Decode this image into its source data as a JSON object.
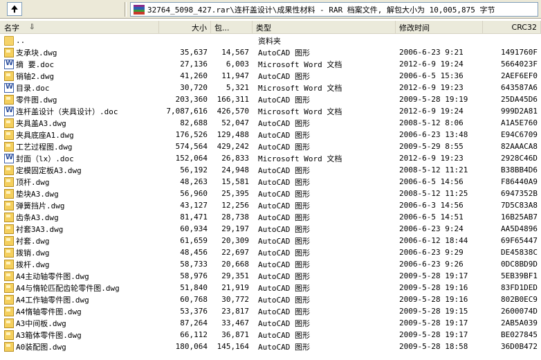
{
  "address_bar": {
    "path": "32764_5098_427.rar\\连杆盖设计\\成果性材料 - RAR 档案文件, 解包大小为 10,005,875 字节"
  },
  "columns": {
    "name": "名字",
    "size": "大小",
    "packed": "包...",
    "type": "类型",
    "modified": "修改时间",
    "crc": "CRC32"
  },
  "colors": {
    "header_bg": "#ebeadb",
    "toolbar_bg": "#ece9d8"
  },
  "rows": [
    {
      "icon": "folder-icon",
      "name": "..",
      "size": "",
      "packed": "",
      "type": "资料夹",
      "modified": "",
      "crc": ""
    },
    {
      "icon": "dwg-icon",
      "name": "支承块.dwg",
      "size": "35,637",
      "packed": "14,567",
      "type": "AutoCAD 图形",
      "modified": "2006-6-23 9:21",
      "crc": "1491760F"
    },
    {
      "icon": "doc-icon",
      "name": "摘   要.doc",
      "size": "27,136",
      "packed": "6,003",
      "type": "Microsoft Word 文档",
      "modified": "2012-6-9 19:24",
      "crc": "5664023F"
    },
    {
      "icon": "dwg-icon",
      "name": "销轴2.dwg",
      "size": "41,260",
      "packed": "11,947",
      "type": "AutoCAD 图形",
      "modified": "2006-6-5 15:36",
      "crc": "2AEF6EF0"
    },
    {
      "icon": "doc-icon",
      "name": "目录.doc",
      "size": "30,720",
      "packed": "5,321",
      "type": "Microsoft Word 文档",
      "modified": "2012-6-9 19:23",
      "crc": "643587A6"
    },
    {
      "icon": "dwg-icon",
      "name": "零件图.dwg",
      "size": "203,360",
      "packed": "166,311",
      "type": "AutoCAD 图形",
      "modified": "2009-5-28 19:19",
      "crc": "25DA45D6"
    },
    {
      "icon": "doc-icon",
      "name": "连杆盖设计（夹具设计）.doc",
      "size": "7,087,616",
      "packed": "426,570",
      "type": "Microsoft Word 文档",
      "modified": "2012-6-9 19:24",
      "crc": "999D2A81"
    },
    {
      "icon": "dwg-icon",
      "name": "夹具盖A3.dwg",
      "size": "82,688",
      "packed": "52,047",
      "type": "AutoCAD 图形",
      "modified": "2008-5-12 8:06",
      "crc": "A1A5E760"
    },
    {
      "icon": "dwg-icon",
      "name": "夹具底座A1.dwg",
      "size": "176,526",
      "packed": "129,488",
      "type": "AutoCAD 图形",
      "modified": "2006-6-23 13:48",
      "crc": "E94C6709"
    },
    {
      "icon": "dwg-icon",
      "name": "工艺过程图.dwg",
      "size": "574,564",
      "packed": "429,242",
      "type": "AutoCAD 图形",
      "modified": "2009-5-29 8:55",
      "crc": "82AAACA8"
    },
    {
      "icon": "doc-icon",
      "name": "封面（lx）.doc",
      "size": "152,064",
      "packed": "26,833",
      "type": "Microsoft Word 文档",
      "modified": "2012-6-9 19:23",
      "crc": "2928C46D"
    },
    {
      "icon": "dwg-icon",
      "name": "定模固定板A3.dwg",
      "size": "56,192",
      "packed": "24,948",
      "type": "AutoCAD 图形",
      "modified": "2008-5-12 11:21",
      "crc": "B38BB4D6"
    },
    {
      "icon": "dwg-icon",
      "name": "顶杆.dwg",
      "size": "48,263",
      "packed": "15,581",
      "type": "AutoCAD 图形",
      "modified": "2006-6-5 14:56",
      "crc": "F86440A9"
    },
    {
      "icon": "dwg-icon",
      "name": "垫块A3.dwg",
      "size": "56,960",
      "packed": "25,395",
      "type": "AutoCAD 图形",
      "modified": "2008-5-12 11:25",
      "crc": "6947352B"
    },
    {
      "icon": "dwg-icon",
      "name": "弹簧挡片.dwg",
      "size": "43,127",
      "packed": "12,256",
      "type": "AutoCAD 图形",
      "modified": "2006-6-3 14:56",
      "crc": "7D5C83A8"
    },
    {
      "icon": "dwg-icon",
      "name": "齿条A3.dwg",
      "size": "81,471",
      "packed": "28,738",
      "type": "AutoCAD 图形",
      "modified": "2006-6-5 14:51",
      "crc": "16B25AB7"
    },
    {
      "icon": "dwg-icon",
      "name": "衬套3A3.dwg",
      "size": "60,934",
      "packed": "29,197",
      "type": "AutoCAD 图形",
      "modified": "2006-6-23 9:24",
      "crc": "AA5D4896"
    },
    {
      "icon": "dwg-icon",
      "name": "衬套.dwg",
      "size": "61,659",
      "packed": "20,309",
      "type": "AutoCAD 图形",
      "modified": "2006-6-12 18:44",
      "crc": "69F65447"
    },
    {
      "icon": "dwg-icon",
      "name": "拨销.dwg",
      "size": "48,456",
      "packed": "22,697",
      "type": "AutoCAD 图形",
      "modified": "2006-6-23 9:29",
      "crc": "DE45838C"
    },
    {
      "icon": "dwg-icon",
      "name": "拨杆.dwg",
      "size": "58,733",
      "packed": "20,668",
      "type": "AutoCAD 图形",
      "modified": "2006-6-23 9:26",
      "crc": "0DC8BD9D"
    },
    {
      "icon": "dwg-icon",
      "name": "A4主动轴零件图.dwg",
      "size": "58,976",
      "packed": "29,351",
      "type": "AutoCAD 图形",
      "modified": "2009-5-28 19:17",
      "crc": "5EB39BF1"
    },
    {
      "icon": "dwg-icon",
      "name": "A4与惰轮匹配齿轮零件图.dwg",
      "size": "51,840",
      "packed": "21,919",
      "type": "AutoCAD 图形",
      "modified": "2009-5-28 19:16",
      "crc": "83FD1DED"
    },
    {
      "icon": "dwg-icon",
      "name": "A4工作轴零件图.dwg",
      "size": "60,768",
      "packed": "30,772",
      "type": "AutoCAD 图形",
      "modified": "2009-5-28 19:16",
      "crc": "802B0EC9"
    },
    {
      "icon": "dwg-icon",
      "name": "A4惰轴零件图.dwg",
      "size": "53,376",
      "packed": "23,817",
      "type": "AutoCAD 图形",
      "modified": "2009-5-28 19:15",
      "crc": "2600074D"
    },
    {
      "icon": "dwg-icon",
      "name": "A3中间板.dwg",
      "size": "87,264",
      "packed": "33,467",
      "type": "AutoCAD 图形",
      "modified": "2009-5-28 19:17",
      "crc": "2AB5A039"
    },
    {
      "icon": "dwg-icon",
      "name": "A3箱体零件图.dwg",
      "size": "66,112",
      "packed": "36,871",
      "type": "AutoCAD 图形",
      "modified": "2009-5-28 19:17",
      "crc": "BE027845"
    },
    {
      "icon": "dwg-icon",
      "name": "A0装配图.dwg",
      "size": "180,064",
      "packed": "145,164",
      "type": "AutoCAD 图形",
      "modified": "2009-5-28 18:58",
      "crc": "36D0B472"
    }
  ]
}
